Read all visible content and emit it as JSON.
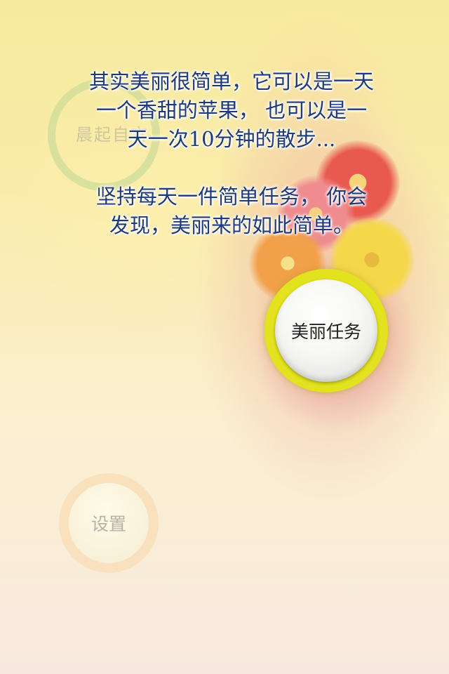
{
  "intro": {
    "line1": "其实美丽很简单，它可以是一天",
    "line2": "一个香甜的苹果， 也可以是一",
    "line3": "天一次10分钟的散步...",
    "line4": "坚持每天一件简单任务， 你会",
    "line5": "发现，美丽来的如此简单。"
  },
  "ghost": {
    "label": "晨起自言"
  },
  "buttons": {
    "task_label": "美丽任务",
    "settings_label": "设置"
  },
  "colors": {
    "text": "#1f3a78",
    "task_ring": "#e2e21e",
    "settings_ring": "#fad7aa"
  }
}
